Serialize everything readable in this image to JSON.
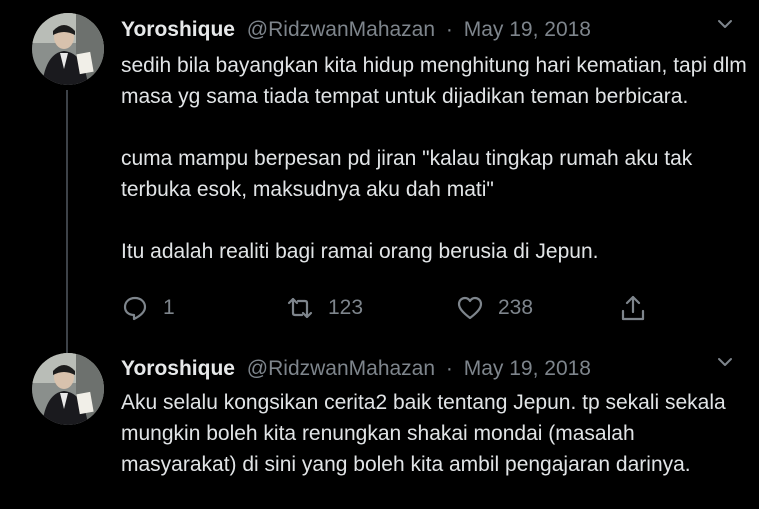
{
  "tweets": [
    {
      "name": "Yoroshique",
      "handle": "@RidzwanMahazan",
      "separator": "·",
      "date": "May 19, 2018",
      "paragraphs": [
        "sedih bila bayangkan kita hidup menghitung hari kematian, tapi dlm masa yg sama tiada tempat untuk dijadikan teman berbicara.",
        "cuma mampu berpesan pd jiran \"kalau tingkap rumah aku tak terbuka esok, maksudnya aku dah mati\"",
        "Itu adalah realiti bagi ramai orang berusia di Jepun."
      ],
      "reply_count": "1",
      "retweet_count": "123",
      "like_count": "238"
    },
    {
      "name": "Yoroshique",
      "handle": "@RidzwanMahazan",
      "separator": "·",
      "date": "May 19, 2018",
      "paragraphs": [
        "Aku selalu kongsikan cerita2 baik tentang Jepun. tp sekali sekala mungkin boleh kita renungkan shakai mondai (masalah masyarakat) di sini yang boleh kita ambil pengajaran darinya."
      ]
    }
  ],
  "icons": {
    "reply": "reply-icon",
    "retweet": "retweet-icon",
    "like": "heart-icon",
    "share": "share-icon",
    "more": "chevron-down-icon"
  },
  "colors": {
    "background": "#000000",
    "text": "#e1e4e6",
    "muted": "#7e858c",
    "thread_line": "#3d4248"
  }
}
